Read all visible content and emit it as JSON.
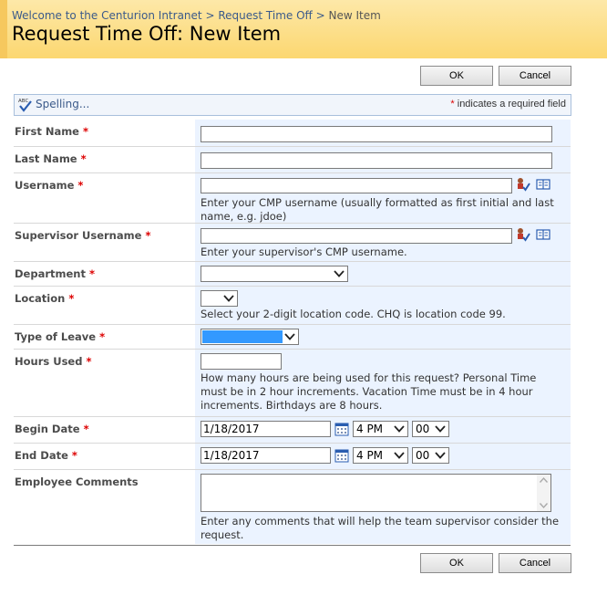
{
  "breadcrumb": {
    "site": "Welcome to the Centurion Intranet",
    "list": "Request Time Off",
    "current": "New Item",
    "separator": ">"
  },
  "page_title": "Request Time Off: New Item",
  "buttons": {
    "ok": "OK",
    "cancel": "Cancel"
  },
  "toolbar": {
    "spelling": "Spelling...",
    "required_star": "*",
    "required_note": "indicates a required field"
  },
  "fields": {
    "first_name": {
      "label": "First Name",
      "value": ""
    },
    "last_name": {
      "label": "Last Name",
      "value": ""
    },
    "username": {
      "label": "Username",
      "value": "",
      "help": "Enter your CMP username (usually formatted as first initial and last name, e.g. jdoe)"
    },
    "supervisor": {
      "label": "Supervisor Username",
      "value": "",
      "help": "Enter your supervisor's CMP username."
    },
    "department": {
      "label": "Department",
      "value": ""
    },
    "location": {
      "label": "Location",
      "value": "",
      "help": "Select your 2-digit location code. CHQ is location code 99."
    },
    "leave_type": {
      "label": "Type of Leave",
      "value": ""
    },
    "hours": {
      "label": "Hours Used",
      "value": "",
      "help": "How many hours are being used for this request? Personal Time must be in 2 hour increments. Vacation Time must be in 4 hour increments. Birthdays are 8 hours."
    },
    "begin_date": {
      "label": "Begin Date",
      "date": "1/18/2017",
      "hour": "4 PM",
      "minute": "00"
    },
    "end_date": {
      "label": "End Date",
      "date": "1/18/2017",
      "hour": "4 PM",
      "minute": "00"
    },
    "comments": {
      "label": "Employee Comments",
      "value": "",
      "help": "Enter any comments that will help the team supervisor consider the request."
    }
  },
  "required_marker": "*",
  "colors": {
    "header": "#fcd770",
    "field_bg": "#ebf3ff",
    "link": "#3b5a8a",
    "required": "#dd0000",
    "selected": "#3399ff"
  }
}
